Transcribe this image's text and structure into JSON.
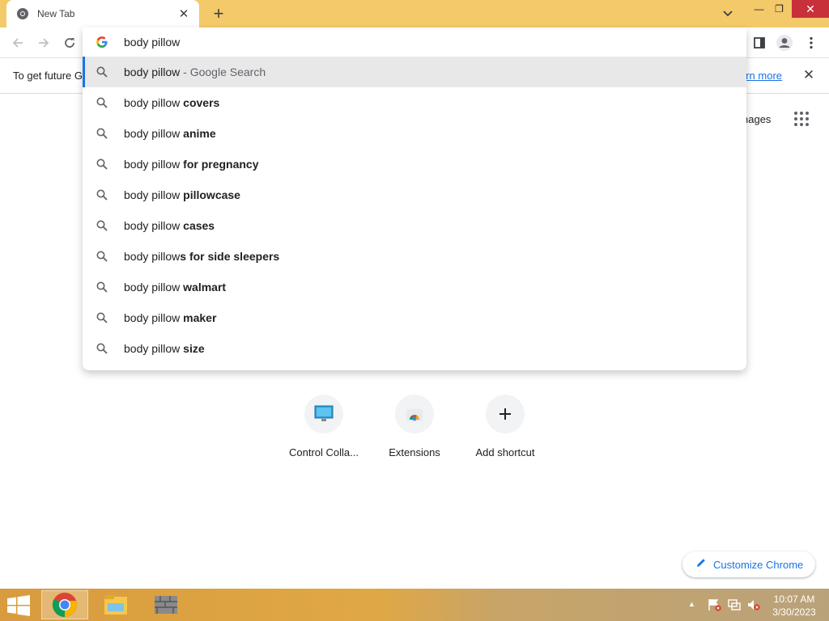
{
  "window": {
    "tab_title": "New Tab",
    "new_tab_icon": "plus-icon",
    "minimize_glyph": "—",
    "maximize_glyph": "❐",
    "close_glyph": "✕"
  },
  "omnibox": {
    "query": "body pillow",
    "icon": "google-g-icon"
  },
  "suggestions": [
    {
      "prefix": "body pillow",
      "bold": "",
      "desc": " - Google Search",
      "selected": true
    },
    {
      "prefix": "body pillow ",
      "bold": "covers",
      "desc": ""
    },
    {
      "prefix": "body pillow ",
      "bold": "anime",
      "desc": ""
    },
    {
      "prefix": "body pillow ",
      "bold": "for pregnancy",
      "desc": ""
    },
    {
      "prefix": "body pillow ",
      "bold": "pillowcase",
      "desc": ""
    },
    {
      "prefix": "body pillow ",
      "bold": "cases",
      "desc": ""
    },
    {
      "prefix": "body pillow",
      "bold": "s for side sleepers",
      "desc": ""
    },
    {
      "prefix": "body pillow ",
      "bold": "walmart",
      "desc": ""
    },
    {
      "prefix": "body pillow ",
      "bold": "maker",
      "desc": ""
    },
    {
      "prefix": "body pillow ",
      "bold": "size",
      "desc": ""
    }
  ],
  "infobar": {
    "text": "To get future G",
    "link": "arn more",
    "close_glyph": "✕"
  },
  "ntp": {
    "images_link": "nages",
    "shortcuts": [
      {
        "label": "Control Colla...",
        "icon": "monitor-icon"
      },
      {
        "label": "Extensions",
        "icon": "chrome-web-store-icon"
      },
      {
        "label": "Add shortcut",
        "icon": "plus-icon"
      }
    ],
    "customize_label": "Customize Chrome"
  },
  "taskbar": {
    "apps": [
      "chrome-icon",
      "file-explorer-icon",
      "firewall-icon"
    ],
    "time": "10:07 AM",
    "date": "3/30/2023"
  },
  "colors": {
    "title_bar": "#f3c96a",
    "accent_blue": "#1a73e8",
    "close_red": "#c8303a",
    "selected_row": "#e8e8e9"
  }
}
